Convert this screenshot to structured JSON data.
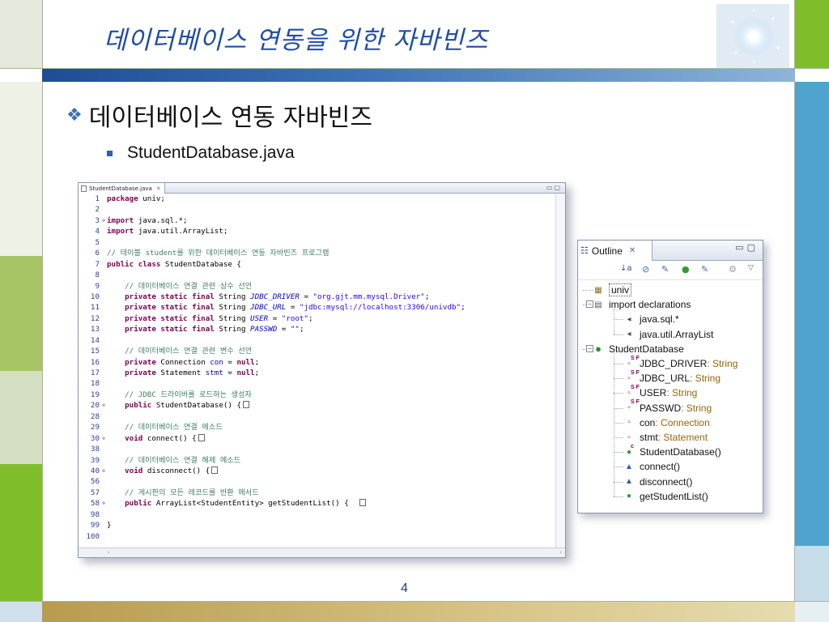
{
  "slide": {
    "title": "데이터베이스 연동을 위한 자바빈즈",
    "bullet_level1": "데이터베이스 연동 자바빈즈",
    "bullet_level2": "StudentDatabase.java",
    "page_number": "4"
  },
  "editor": {
    "tab_label": "StudentDatabase.java",
    "lines": [
      {
        "n": "1",
        "fold": "",
        "html": "<span class=\"kw\">package</span> univ;"
      },
      {
        "n": "2",
        "fold": "",
        "html": ""
      },
      {
        "n": "3",
        "fold": "⊕",
        "html": "<span class=\"kw\">import</span> java.sql.*;"
      },
      {
        "n": "4",
        "fold": "",
        "html": "<span class=\"kw\">import</span> java.util.ArrayList;"
      },
      {
        "n": "5",
        "fold": "",
        "html": ""
      },
      {
        "n": "6",
        "fold": "",
        "html": "<span class=\"cm\">// 테이블 student를 위한 데이터베이스 연동 자바빈즈 프로그램</span>"
      },
      {
        "n": "7",
        "fold": "",
        "html": "<span class=\"kw\">public class</span> StudentDatabase {"
      },
      {
        "n": "8",
        "fold": "",
        "html": ""
      },
      {
        "n": "9",
        "fold": "",
        "html": "    <span class=\"cm\">// 데이터베이스 연결 관련 상수 선언</span>"
      },
      {
        "n": "10",
        "fold": "",
        "html": "    <span class=\"kw\">private static final</span> String <span class=\"fi\">JDBC_DRIVER</span> = <span class=\"st\">\"org.gjt.mm.mysql.Driver\"</span>;"
      },
      {
        "n": "11",
        "fold": "",
        "html": "    <span class=\"kw\">private static final</span> String <span class=\"fi\">JDBC_URL</span> = <span class=\"st\">\"jdbc:mysql://localhost:3306/univdb\"</span>;"
      },
      {
        "n": "12",
        "fold": "",
        "html": "    <span class=\"kw\">private static final</span> String <span class=\"fi\">USER</span> = <span class=\"st\">\"root\"</span>;"
      },
      {
        "n": "13",
        "fold": "",
        "html": "    <span class=\"kw\">private static final</span> String <span class=\"fi\">PASSWD</span> = <span class=\"st\">\"\"</span>;"
      },
      {
        "n": "14",
        "fold": "",
        "html": ""
      },
      {
        "n": "15",
        "fold": "",
        "html": "    <span class=\"cm\">// 데이터베이스 연결 관련 변수 선언</span>"
      },
      {
        "n": "16",
        "fold": "",
        "html": "    <span class=\"kw\">private</span> Connection <span class=\"fv\">con</span> = <span class=\"kw\">null</span>;"
      },
      {
        "n": "17",
        "fold": "",
        "html": "    <span class=\"kw\">private</span> Statement <span class=\"fv\">stmt</span> = <span class=\"kw\">null</span>;"
      },
      {
        "n": "18",
        "fold": "",
        "html": ""
      },
      {
        "n": "19",
        "fold": "",
        "html": "    <span class=\"cm\">// JDBC 드라이버를 로드하는 생성자</span>"
      },
      {
        "n": "20",
        "fold": "⊕",
        "html": "    <span class=\"kw\">public</span> StudentDatabase() {<span class=\"box\"></span>"
      },
      {
        "n": "28",
        "fold": "",
        "html": ""
      },
      {
        "n": "29",
        "fold": "",
        "html": "    <span class=\"cm\">// 데이터베이스 연결 메소드</span>"
      },
      {
        "n": "30",
        "fold": "⊕",
        "html": "    <span class=\"kw\">void</span> connect() {<span class=\"box\"></span>"
      },
      {
        "n": "38",
        "fold": "",
        "html": ""
      },
      {
        "n": "39",
        "fold": "",
        "html": "    <span class=\"cm\">// 데이터베이스 연결 해제 메소드</span>"
      },
      {
        "n": "40",
        "fold": "⊕",
        "html": "    <span class=\"kw\">void</span> disconnect() {<span class=\"box\"></span>"
      },
      {
        "n": "56",
        "fold": "",
        "html": ""
      },
      {
        "n": "57",
        "fold": "",
        "html": "    <span class=\"cm\">// 게시판의 모든 레코드를 반환 메서드</span>"
      },
      {
        "n": "58",
        "fold": "⊕",
        "html": "    <span class=\"kw\">public</span> ArrayList&lt;StudentEntity&gt; getStudentList() {  <span class=\"box\"></span>"
      },
      {
        "n": "98",
        "fold": "",
        "html": ""
      },
      {
        "n": "99",
        "fold": "",
        "html": "}"
      },
      {
        "n": "100",
        "fold": "",
        "html": ""
      }
    ]
  },
  "outline": {
    "tab_label": "Outline",
    "items": [
      {
        "label": "univ",
        "type": "",
        "depth": 0,
        "icon": "package-icon",
        "sup": ""
      },
      {
        "label": "import declarations",
        "type": "",
        "depth": 0,
        "icon": "imports-icon",
        "sup": ""
      },
      {
        "label": "java.sql.*",
        "type": "",
        "depth": 1,
        "icon": "import-icon",
        "sup": ""
      },
      {
        "label": "java.util.ArrayList",
        "type": "",
        "depth": 1,
        "icon": "import-icon",
        "sup": ""
      },
      {
        "label": "StudentDatabase",
        "type": "",
        "depth": 0,
        "icon": "class-icon",
        "sup": ""
      },
      {
        "label": "JDBC_DRIVER",
        "type": " : String",
        "depth": 1,
        "icon": "private-field-icon",
        "sup": "S F"
      },
      {
        "label": "JDBC_URL",
        "type": " : String",
        "depth": 1,
        "icon": "private-field-icon",
        "sup": "S F"
      },
      {
        "label": "USER",
        "type": " : String",
        "depth": 1,
        "icon": "private-field-icon",
        "sup": "S F"
      },
      {
        "label": "PASSWD",
        "type": " : String",
        "depth": 1,
        "icon": "private-field-icon",
        "sup": "S F"
      },
      {
        "label": "con",
        "type": " : Connection",
        "depth": 1,
        "icon": "private-field-icon",
        "sup": ""
      },
      {
        "label": "stmt",
        "type": " : Statement",
        "depth": 1,
        "icon": "private-field-icon",
        "sup": ""
      },
      {
        "label": "StudentDatabase()",
        "type": "",
        "depth": 1,
        "icon": "constructor-icon",
        "sup": "c"
      },
      {
        "label": "connect()",
        "type": "",
        "depth": 1,
        "icon": "default-method-icon",
        "sup": ""
      },
      {
        "label": "disconnect()",
        "type": "",
        "depth": 1,
        "icon": "default-method-icon",
        "sup": ""
      },
      {
        "label": "getStudentList()",
        "type": "",
        "depth": 1,
        "icon": "public-method-icon",
        "sup": ""
      }
    ]
  },
  "colors": {
    "title": "#1f4da8",
    "keyword": "#7f0055",
    "comment": "#3f7f5f",
    "string": "#2a00ff",
    "field": "#0000c0",
    "type_hint": "#95650a"
  }
}
